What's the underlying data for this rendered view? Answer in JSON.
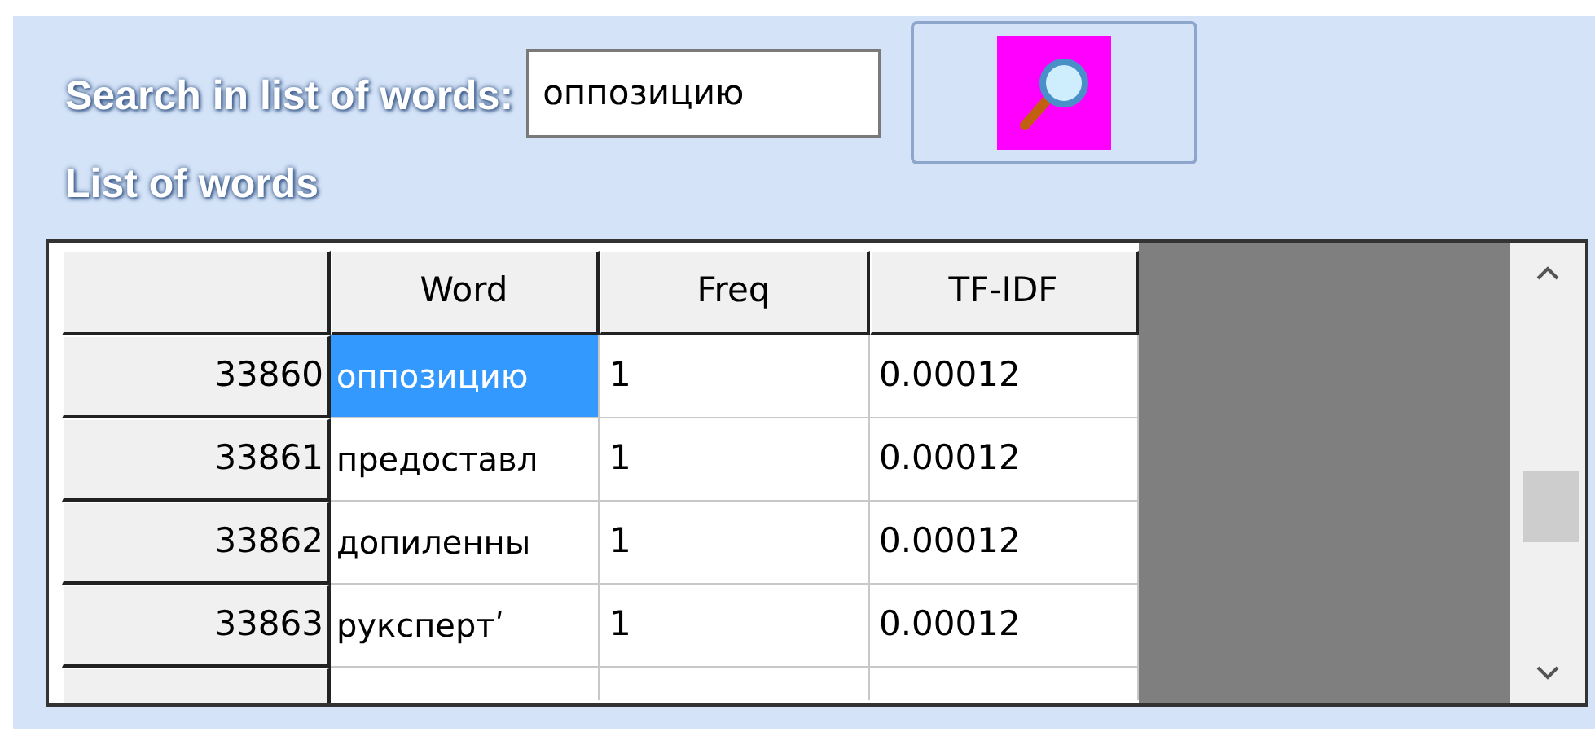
{
  "search": {
    "label": "Search in list of words:",
    "value": "оппозицию"
  },
  "list_title": "List of words",
  "table": {
    "columns": [
      "Word",
      "Freq",
      "TF-IDF"
    ],
    "rows": [
      {
        "index": "33860",
        "word": "оппозицию",
        "freq": "1",
        "tfidf": "0.00012",
        "selected": true
      },
      {
        "index": "33861",
        "word": "предоставл",
        "freq": "1",
        "tfidf": "0.00012",
        "selected": false
      },
      {
        "index": "33862",
        "word": "допиленны",
        "freq": "1",
        "tfidf": "0.00012",
        "selected": false
      },
      {
        "index": "33863",
        "word": "рукспертʹ",
        "freq": "1",
        "tfidf": "0.00012",
        "selected": false
      }
    ]
  }
}
